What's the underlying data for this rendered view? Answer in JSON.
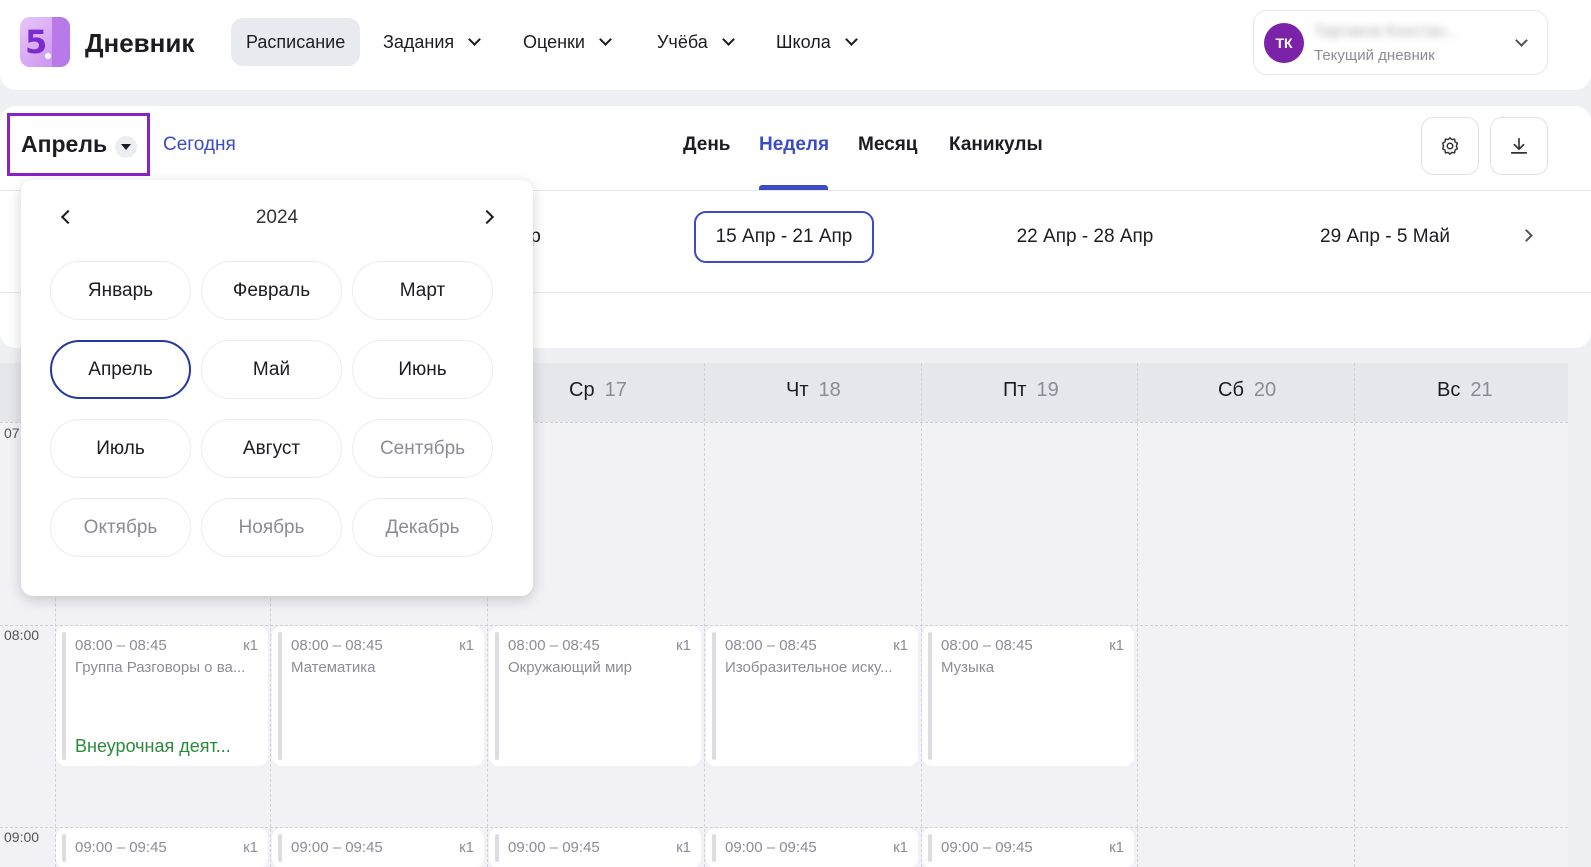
{
  "header": {
    "logo_glyph": "5",
    "app_title": "Дневник",
    "nav": [
      {
        "label": "Расписание",
        "active": true
      },
      {
        "label": "Задания"
      },
      {
        "label": "Оценки"
      },
      {
        "label": "Учёба"
      },
      {
        "label": "Школа"
      }
    ],
    "profile": {
      "initials": "ТК",
      "name": "Тартаков Констан...",
      "subtitle": "Текущий дневник"
    }
  },
  "toolbar": {
    "month_select": "Апрель",
    "today": "Сегодня",
    "views": [
      "День",
      "Неделя",
      "Месяц",
      "Каникулы"
    ],
    "active_view": "Неделя",
    "settings_icon": "settings-gear-icon",
    "download_icon": "download-icon"
  },
  "weeks": {
    "partial_prev": "пр",
    "items": [
      "15 Апр - 21 Апр",
      "22 Апр - 28 Апр",
      "29 Апр - 5 Май"
    ],
    "selected": "15 Апр - 21 Апр"
  },
  "month_picker": {
    "year": "2024",
    "months": [
      {
        "label": "Январь"
      },
      {
        "label": "Февраль"
      },
      {
        "label": "Март"
      },
      {
        "label": "Апрель",
        "selected": true
      },
      {
        "label": "Май"
      },
      {
        "label": "Июнь"
      },
      {
        "label": "Июль"
      },
      {
        "label": "Август"
      },
      {
        "label": "Сентябрь",
        "disabled": true
      },
      {
        "label": "Октябрь",
        "disabled": true
      },
      {
        "label": "Ноябрь",
        "disabled": true
      },
      {
        "label": "Декабрь",
        "disabled": true
      }
    ]
  },
  "calendar": {
    "days": [
      {
        "name": "Ср",
        "num": "17"
      },
      {
        "name": "Чт",
        "num": "18"
      },
      {
        "name": "Пт",
        "num": "19"
      },
      {
        "name": "Сб",
        "num": "20"
      },
      {
        "name": "Вс",
        "num": "21"
      }
    ],
    "times": [
      "07",
      "08:00",
      "09:00"
    ],
    "lessons_8": [
      {
        "time": "08:00 – 08:45",
        "room": "к1",
        "subject": "Группа Разговоры о ва...",
        "tag": "Внеурочная деят..."
      },
      {
        "time": "08:00 – 08:45",
        "room": "к1",
        "subject": "Математика"
      },
      {
        "time": "08:00 – 08:45",
        "room": "к1",
        "subject": "Окружающий мир"
      },
      {
        "time": "08:00 – 08:45",
        "room": "к1",
        "subject": "Изобразительное иску..."
      },
      {
        "time": "08:00 – 08:45",
        "room": "к1",
        "subject": "Музыка"
      }
    ],
    "lessons_9": [
      {
        "time": "09:00 – 09:45",
        "room": "к1"
      },
      {
        "time": "09:00 – 09:45",
        "room": "к1"
      },
      {
        "time": "09:00 – 09:45",
        "room": "к1"
      },
      {
        "time": "09:00 – 09:45",
        "room": "к1"
      },
      {
        "time": "09:00 – 09:45",
        "room": "к1"
      }
    ]
  }
}
